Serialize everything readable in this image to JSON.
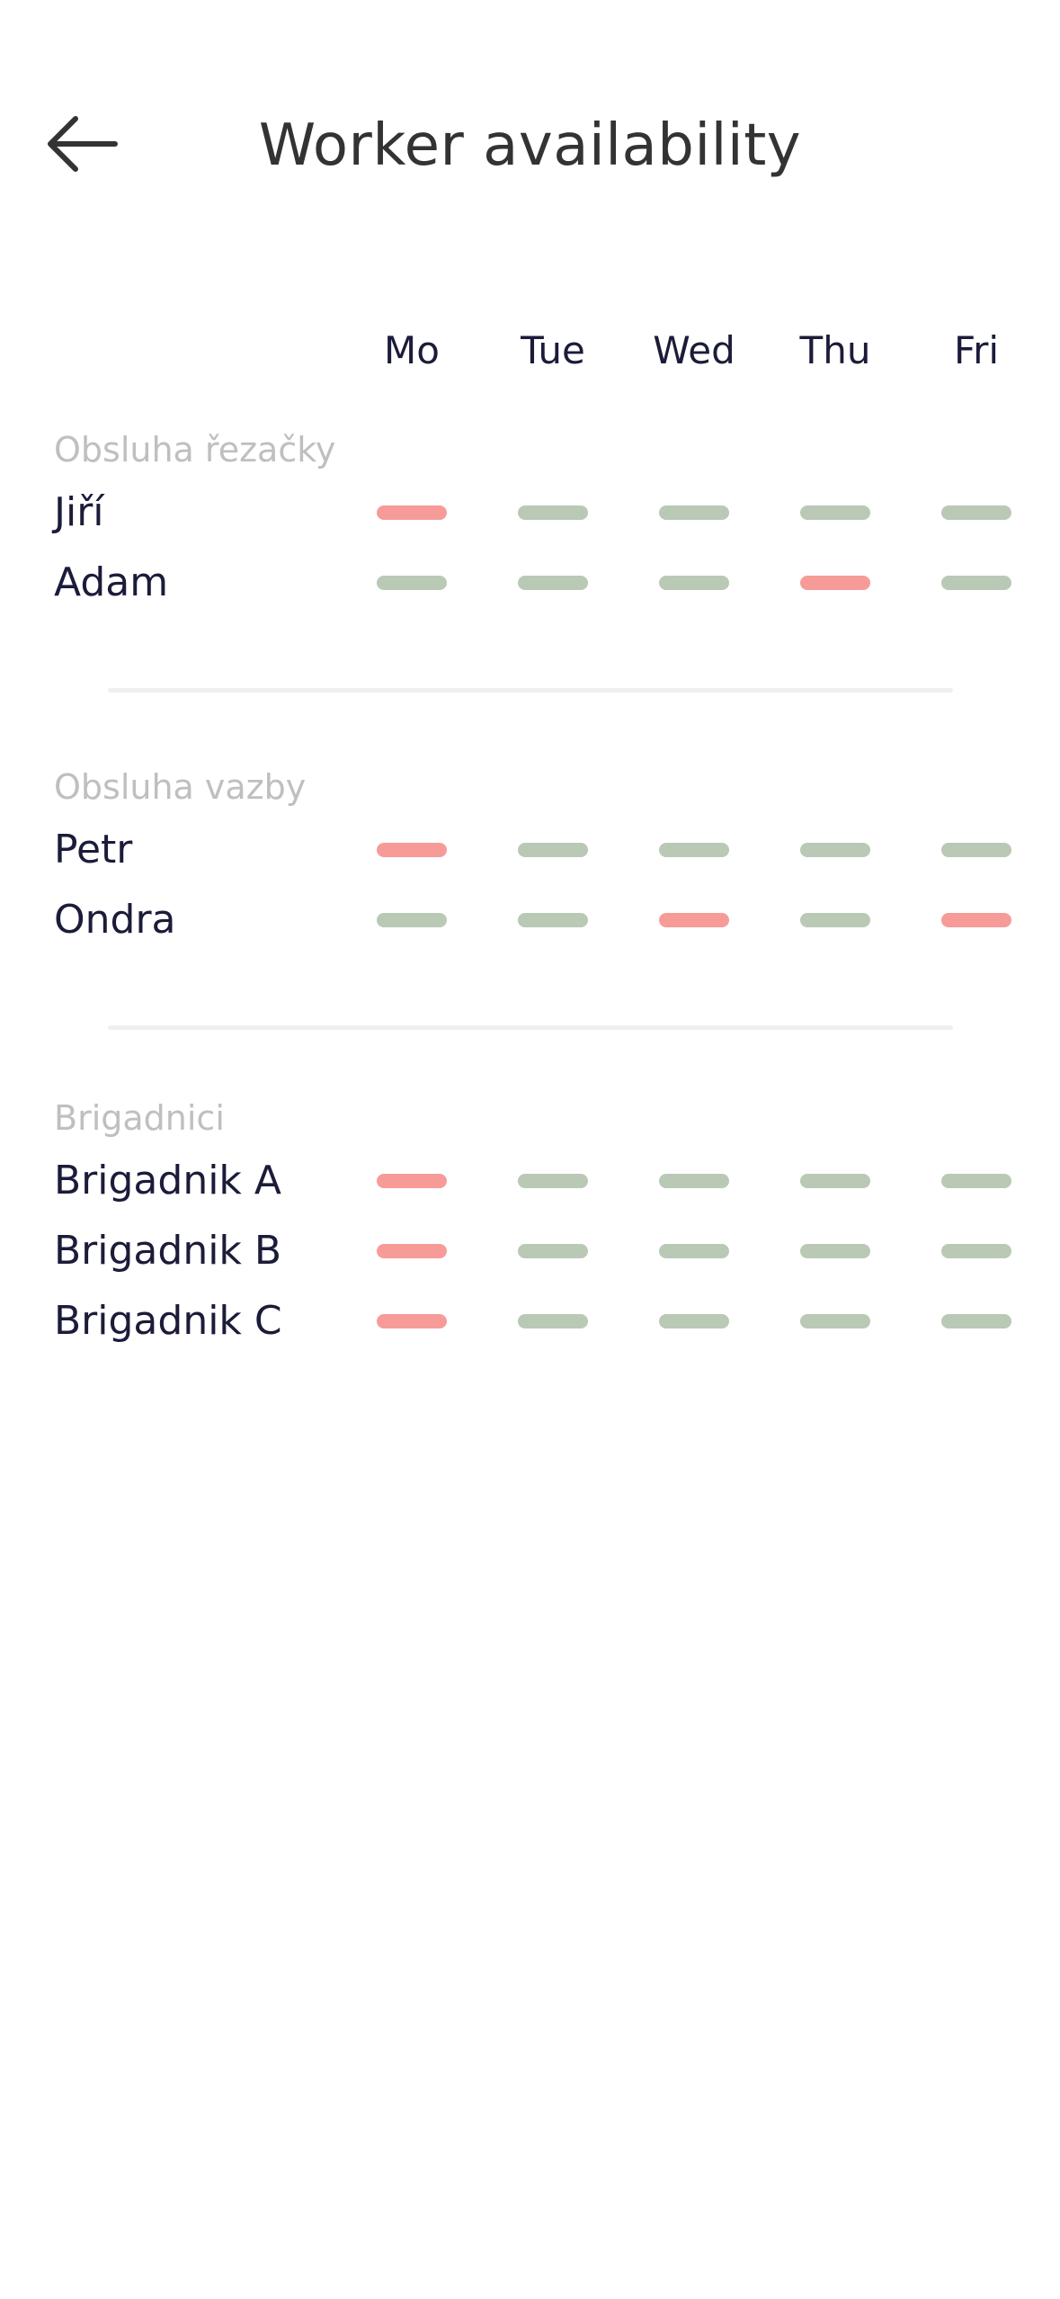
{
  "header": {
    "title": "Worker availability",
    "back_icon": "arrow-left-icon"
  },
  "days": [
    "Mo",
    "Tue",
    "Wed",
    "Thu",
    "Fri"
  ],
  "status_colors": {
    "available": "#b9c9b5",
    "unavailable": "#f79b99"
  },
  "groups": [
    {
      "title": "Obsluha řezačky",
      "workers": [
        {
          "name": "Jiří",
          "availability": [
            "unavailable",
            "available",
            "available",
            "available",
            "available"
          ]
        },
        {
          "name": "Adam",
          "availability": [
            "available",
            "available",
            "available",
            "unavailable",
            "available"
          ]
        }
      ]
    },
    {
      "title": "Obsluha vazby",
      "workers": [
        {
          "name": "Petr",
          "availability": [
            "unavailable",
            "available",
            "available",
            "available",
            "available"
          ]
        },
        {
          "name": "Ondra",
          "availability": [
            "available",
            "available",
            "unavailable",
            "available",
            "unavailable"
          ]
        }
      ]
    },
    {
      "title": "Brigadnici",
      "workers": [
        {
          "name": "Brigadnik A",
          "availability": [
            "unavailable",
            "available",
            "available",
            "available",
            "available"
          ]
        },
        {
          "name": "Brigadnik B",
          "availability": [
            "unavailable",
            "available",
            "available",
            "available",
            "available"
          ]
        },
        {
          "name": "Brigadnik C",
          "availability": [
            "unavailable",
            "available",
            "available",
            "available",
            "available"
          ]
        }
      ]
    }
  ]
}
